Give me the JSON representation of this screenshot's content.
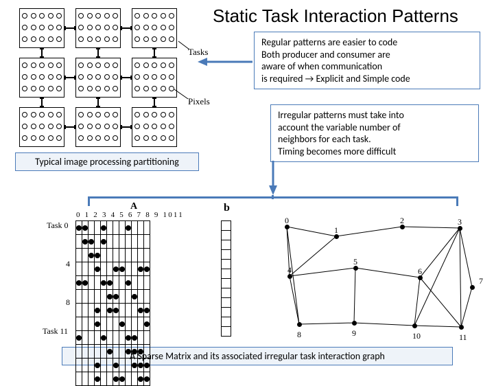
{
  "title": "Static Task Interaction Patterns",
  "box_regular": {
    "line1": "Regular patterns are easier to code",
    "line2": "Both producer and consumer are",
    "line3": "aware of when communication",
    "line4": "is required → Explicit and Simple code"
  },
  "box_irregular": {
    "line1": "Irregular patterns must take into",
    "line2": "account the variable number of",
    "line3": "neighbors for each task.",
    "line4": "Timing becomes more difficult"
  },
  "caption_typical": "Typical image processing partitioning",
  "caption_bottom": "A Sparse Matrix and its associated irregular task interaction graph",
  "labels": {
    "tasks": "Tasks",
    "pixels": "Pixels",
    "A": "A",
    "b": "b",
    "task0": "Task 0",
    "row4": "4",
    "row8": "8",
    "task11": "Task 11"
  },
  "matrix_cols": "0 1 2 3 4 5 6 7 8 9 1011",
  "graph_nodes": [
    "0",
    "1",
    "2",
    "3",
    "4",
    "5",
    "6",
    "7",
    "8",
    "9",
    "10",
    "11"
  ],
  "chart_data": {
    "type": "diagram",
    "sparse_matrix": {
      "rows": 12,
      "cols": 12,
      "nonzeros": [
        [
          0,
          0
        ],
        [
          0,
          1
        ],
        [
          0,
          4
        ],
        [
          0,
          8
        ],
        [
          1,
          1
        ],
        [
          1,
          2
        ],
        [
          1,
          4
        ],
        [
          2,
          2
        ],
        [
          2,
          3
        ],
        [
          3,
          3
        ],
        [
          3,
          6
        ],
        [
          3,
          7
        ],
        [
          3,
          10
        ],
        [
          3,
          11
        ],
        [
          4,
          0
        ],
        [
          4,
          1
        ],
        [
          4,
          4
        ],
        [
          4,
          5
        ],
        [
          4,
          8
        ],
        [
          5,
          5
        ],
        [
          5,
          6
        ],
        [
          5,
          9
        ],
        [
          6,
          3
        ],
        [
          6,
          5
        ],
        [
          6,
          6
        ],
        [
          6,
          10
        ],
        [
          6,
          11
        ],
        [
          7,
          3
        ],
        [
          7,
          7
        ],
        [
          7,
          11
        ],
        [
          8,
          0
        ],
        [
          8,
          4
        ],
        [
          8,
          8
        ],
        [
          8,
          9
        ],
        [
          9,
          5
        ],
        [
          9,
          8
        ],
        [
          9,
          9
        ],
        [
          9,
          10
        ],
        [
          10,
          3
        ],
        [
          10,
          6
        ],
        [
          10,
          9
        ],
        [
          10,
          10
        ],
        [
          10,
          11
        ],
        [
          11,
          3
        ],
        [
          11,
          6
        ],
        [
          11,
          7
        ],
        [
          11,
          10
        ],
        [
          11,
          11
        ]
      ]
    },
    "graph": {
      "edges": [
        [
          0,
          1
        ],
        [
          0,
          4
        ],
        [
          0,
          8
        ],
        [
          1,
          2
        ],
        [
          1,
          4
        ],
        [
          2,
          3
        ],
        [
          3,
          6
        ],
        [
          3,
          7
        ],
        [
          3,
          10
        ],
        [
          3,
          11
        ],
        [
          4,
          5
        ],
        [
          4,
          8
        ],
        [
          5,
          6
        ],
        [
          5,
          9
        ],
        [
          6,
          10
        ],
        [
          6,
          11
        ],
        [
          7,
          11
        ],
        [
          8,
          9
        ],
        [
          9,
          10
        ],
        [
          10,
          11
        ]
      ]
    }
  }
}
